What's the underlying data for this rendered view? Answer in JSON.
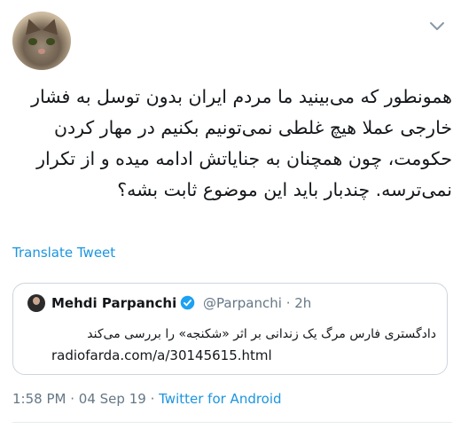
{
  "tweet": {
    "text": "همونطور که می‌بینید ما مردم ایران بدون توسل به فشار خارجی عملا هیچ غلطی نمی‌تونیم بکنیم در مهار کردن حکومت، چون همچنان به جنایاتش ادامه میده و از تکرار نمی‌ترسه. چندبار باید این موضوع ثابت بشه؟",
    "translate_label": "Translate Tweet"
  },
  "quoted": {
    "name": "Mehdi Parpanchi",
    "handle": "@Parpanchi",
    "separator": "·",
    "time": "2h",
    "text": "دادگستری فارس مرگ یک زندانی بر اثر «شکنجه» را بررسی می‌کند",
    "link": "radiofarda.com/a/30145615.html"
  },
  "meta": {
    "time": "1:58 PM",
    "separator": "·",
    "date": "04 Sep 19",
    "source": "Twitter for Android"
  },
  "icons": {
    "menu": "chevron-down-icon",
    "verified": "verified-badge-icon"
  },
  "colors": {
    "link": "#1b95e0",
    "secondary": "#657786",
    "border": "#ccd6dd"
  }
}
